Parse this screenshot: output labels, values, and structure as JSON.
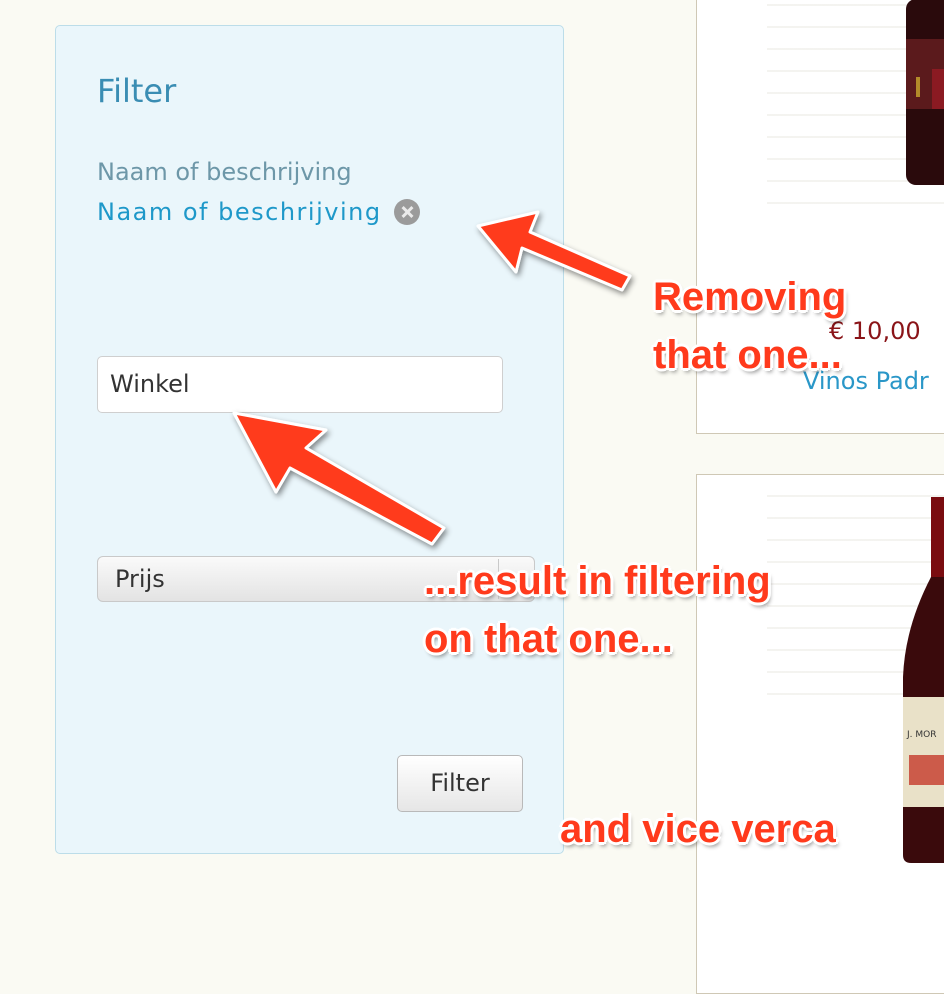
{
  "filter": {
    "title": "Filter",
    "field_label": "Naam of beschrijving",
    "active_filter_value": "Naam of beschrijving",
    "shop_input_value": "Winkel",
    "price_select_value": "Prijs",
    "submit_label": "Filter"
  },
  "products": {
    "price": "€ 10,00",
    "shop_link": "Vinos Padr"
  },
  "annotations": {
    "removing": [
      "Removing",
      "that one..."
    ],
    "filtering": [
      "...result in filtering",
      "on that one..."
    ],
    "vice_versa": "and vice verca"
  },
  "colors": {
    "annotation": "#ff3a1c",
    "link": "#1e98c9",
    "price": "#8a1418"
  }
}
